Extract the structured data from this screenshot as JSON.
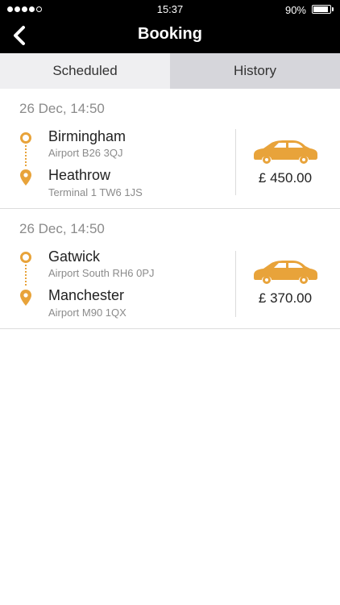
{
  "status_bar": {
    "time": "15:37",
    "battery": "90%"
  },
  "header": {
    "title": "Booking"
  },
  "tabs": [
    {
      "label": "Scheduled",
      "active": true
    },
    {
      "label": "History",
      "active": false
    }
  ],
  "bookings": [
    {
      "date": "26 Dec, 14:50",
      "pickup": {
        "name": "Birmingham",
        "address": "Airport B26 3QJ"
      },
      "dropoff": {
        "name": "Heathrow",
        "address": "Terminal 1 TW6 1JS"
      },
      "price": "£ 450.00"
    },
    {
      "date": "26 Dec, 14:50",
      "pickup": {
        "name": "Gatwick",
        "address": "Airport South RH6 0PJ"
      },
      "dropoff": {
        "name": "Manchester",
        "address": "Airport M90 1QX"
      },
      "price": "£ 370.00"
    }
  ],
  "colors": {
    "accent": "#e8a33a",
    "header_bg": "#000000"
  },
  "icons": {
    "back": "chevron-left-icon",
    "origin": "circle-icon",
    "destination": "map-pin-icon",
    "vehicle": "car-icon"
  }
}
